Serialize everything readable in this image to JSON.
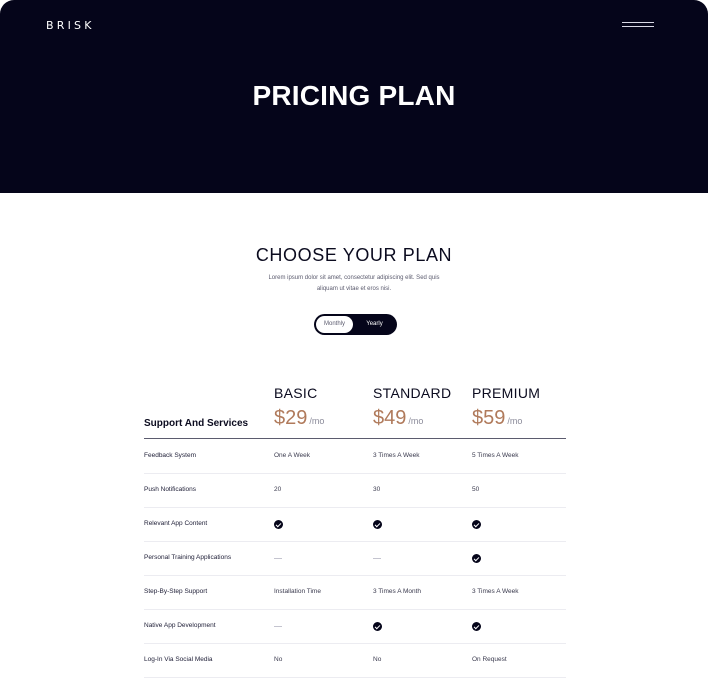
{
  "brand": "BRISK",
  "hero": {
    "title": "PRICING PLAN"
  },
  "section": {
    "title": "CHOOSE YOUR PLAN",
    "description": "Lorem ipsum dolor sit amet, consectetur adipiscing elit. Sed quis aliquam ut vitae et eros nisi."
  },
  "toggle": {
    "monthly": "Monthly",
    "yearly": "Yearly",
    "selected": "Monthly"
  },
  "table": {
    "support_header": "Support And Services",
    "plans": [
      {
        "name": "BASIC",
        "price": "$29",
        "period": "/mo"
      },
      {
        "name": "STANDARD",
        "price": "$49",
        "period": "/mo"
      },
      {
        "name": "PREMIUM",
        "price": "$59",
        "period": "/mo"
      }
    ],
    "rows": [
      {
        "feature": "Feedback System",
        "values": [
          "One A Week",
          "3 Times A Week",
          "5 Times A Week"
        ]
      },
      {
        "feature": "Push Notifications",
        "values": [
          "20",
          "30",
          "50"
        ]
      },
      {
        "feature": "Relevant App Content",
        "values": [
          "check",
          "check",
          "check"
        ]
      },
      {
        "feature": "Personal Training Applications",
        "values": [
          "dash",
          "dash",
          "check"
        ]
      },
      {
        "feature": "Step-By-Step Support",
        "values": [
          "Installation Time",
          "3 Times A Month",
          "3 Times A Week"
        ]
      },
      {
        "feature": "Native App Development",
        "values": [
          "dash",
          "check",
          "check"
        ]
      },
      {
        "feature": "Log-In Via Social Media",
        "values": [
          "No",
          "No",
          "On Request"
        ]
      }
    ]
  },
  "icons": {
    "menu": "hamburger-menu-icon",
    "check": "check-circle-icon",
    "dash": "dash-icon"
  },
  "colors": {
    "dark": "#05051a",
    "price_accent": "#b07a5b",
    "background": "#ffffff"
  }
}
